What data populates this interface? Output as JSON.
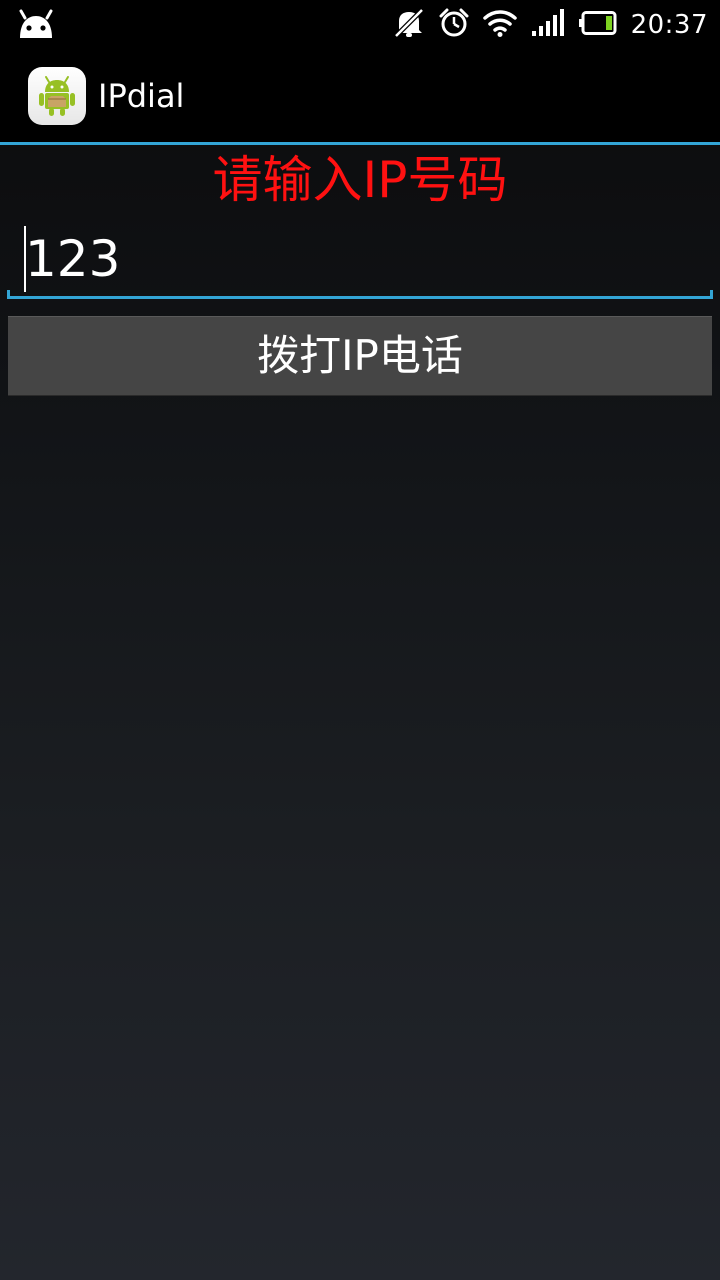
{
  "status_bar": {
    "time": "20:37",
    "icons": [
      "android-notification-icon",
      "mute-icon",
      "alarm-icon",
      "wifi-icon",
      "signal-icon",
      "battery-icon"
    ]
  },
  "action_bar": {
    "title": "IPdial",
    "app_icon": "android-app-icon"
  },
  "content": {
    "prompt_label": "请输入IP号码",
    "ip_input_value": "123",
    "dial_button_label": "拨打IP电话"
  },
  "colors": {
    "accent": "#33a5d6",
    "prompt": "#ff1111",
    "button": "#454545"
  }
}
